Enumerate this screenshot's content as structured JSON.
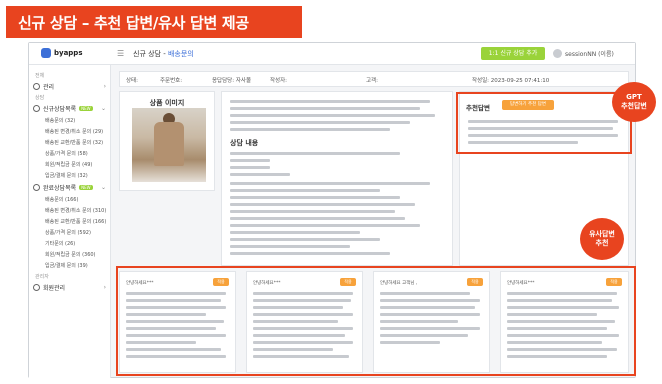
{
  "banner": {
    "title": "신규 상담 – 추천 답변/유사 답변 제공"
  },
  "app": {
    "logo_text": "byapps",
    "breadcrumb_prefix": "신규 상담 -",
    "breadcrumb_current": "배송문의",
    "register_button": "1:1 신규 상담 추가",
    "user_name": "sessionNN (이름)"
  },
  "sidebar": {
    "sections": [
      {
        "label": "전체"
      },
      {
        "label": "상담"
      },
      {
        "label": "관리자"
      }
    ],
    "groups": [
      {
        "label": "관리",
        "icon": "gear-icon"
      },
      {
        "label": "신규상담목록",
        "badge": "NEW",
        "icon": "clock-icon",
        "items": [
          "배송문의 (32)",
          "배송된 변경/취소 문의 (29)",
          "배송된 교환/반품 문의 (32)",
          "상품/가격 문의 (58)",
          "회원/적립금 문의 (49)",
          "입금/결제 문의 (32)"
        ]
      },
      {
        "label": "완료상담목록",
        "badge": "NEW",
        "icon": "check-circle-icon",
        "items": [
          "배송문의 (166)",
          "배송된 변경/취소 문의 (310)",
          "배송된 교환/반품 문의 (166)",
          "상품/가격 문의 (592)",
          "기타문의 (26)",
          "회원/적립금 문의 (360)",
          "입금/결제 문의 (39)"
        ]
      },
      {
        "label": "회원관리",
        "icon": "user-icon"
      }
    ]
  },
  "inforow": {
    "status": "상태:",
    "order_no": "주문번호:",
    "manager": "응답담당: 자사몰",
    "writer": "작성자:",
    "customer": "고객:",
    "date": "작성일: 2023-09-25 07:41:10"
  },
  "product": {
    "title": "상품 이미지"
  },
  "inquiry": {
    "detail_title": "상담 내용"
  },
  "gpt": {
    "title": "추천답변",
    "button": "답변하기 추천 답변",
    "callout_top": "GPT",
    "callout_bottom": "추천답변"
  },
  "similar": {
    "callout_top": "유사답변",
    "callout_bottom": "추천",
    "cards": [
      {
        "label": "안녕하세요***",
        "apply": "적용"
      },
      {
        "label": "안녕하세요***",
        "apply": "적용"
      },
      {
        "label": "안녕하세요 고객님 ,",
        "apply": "적용"
      },
      {
        "label": "안녕하세요***",
        "apply": "적용"
      }
    ]
  },
  "colors": {
    "accent": "#e8441f",
    "brand": "#3c6fd8",
    "green": "#9ad33a",
    "orange": "#f7a23b"
  }
}
